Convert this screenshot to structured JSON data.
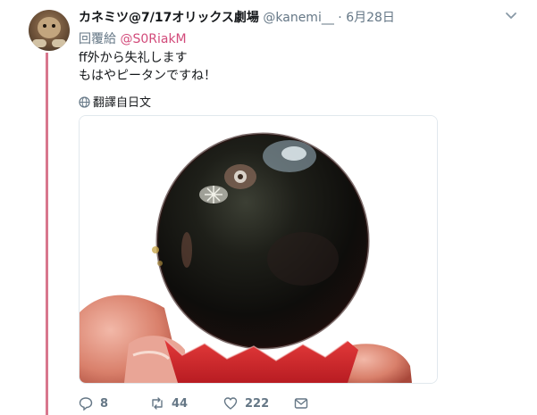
{
  "tweet": {
    "display_name": "カネミツ@7/17オリックス劇場",
    "handle": "@kanemi__",
    "separator": "·",
    "date": "6月28日",
    "reply_label": "回覆給",
    "reply_to": "@S0RiakM",
    "text_line1": "ff外から失礼します",
    "text_line2": "もはやピータンですね！",
    "translate_label": "翻譯自日文"
  },
  "actions": {
    "replies": "8",
    "retweets": "44",
    "likes": "222"
  },
  "colors": {
    "thread_line": "#d8778d",
    "mention": "#d24a7a",
    "muted": "#657786"
  },
  "icons": [
    "chevron-down-icon",
    "globe-icon",
    "reply-icon",
    "retweet-icon",
    "like-icon",
    "message-icon"
  ]
}
